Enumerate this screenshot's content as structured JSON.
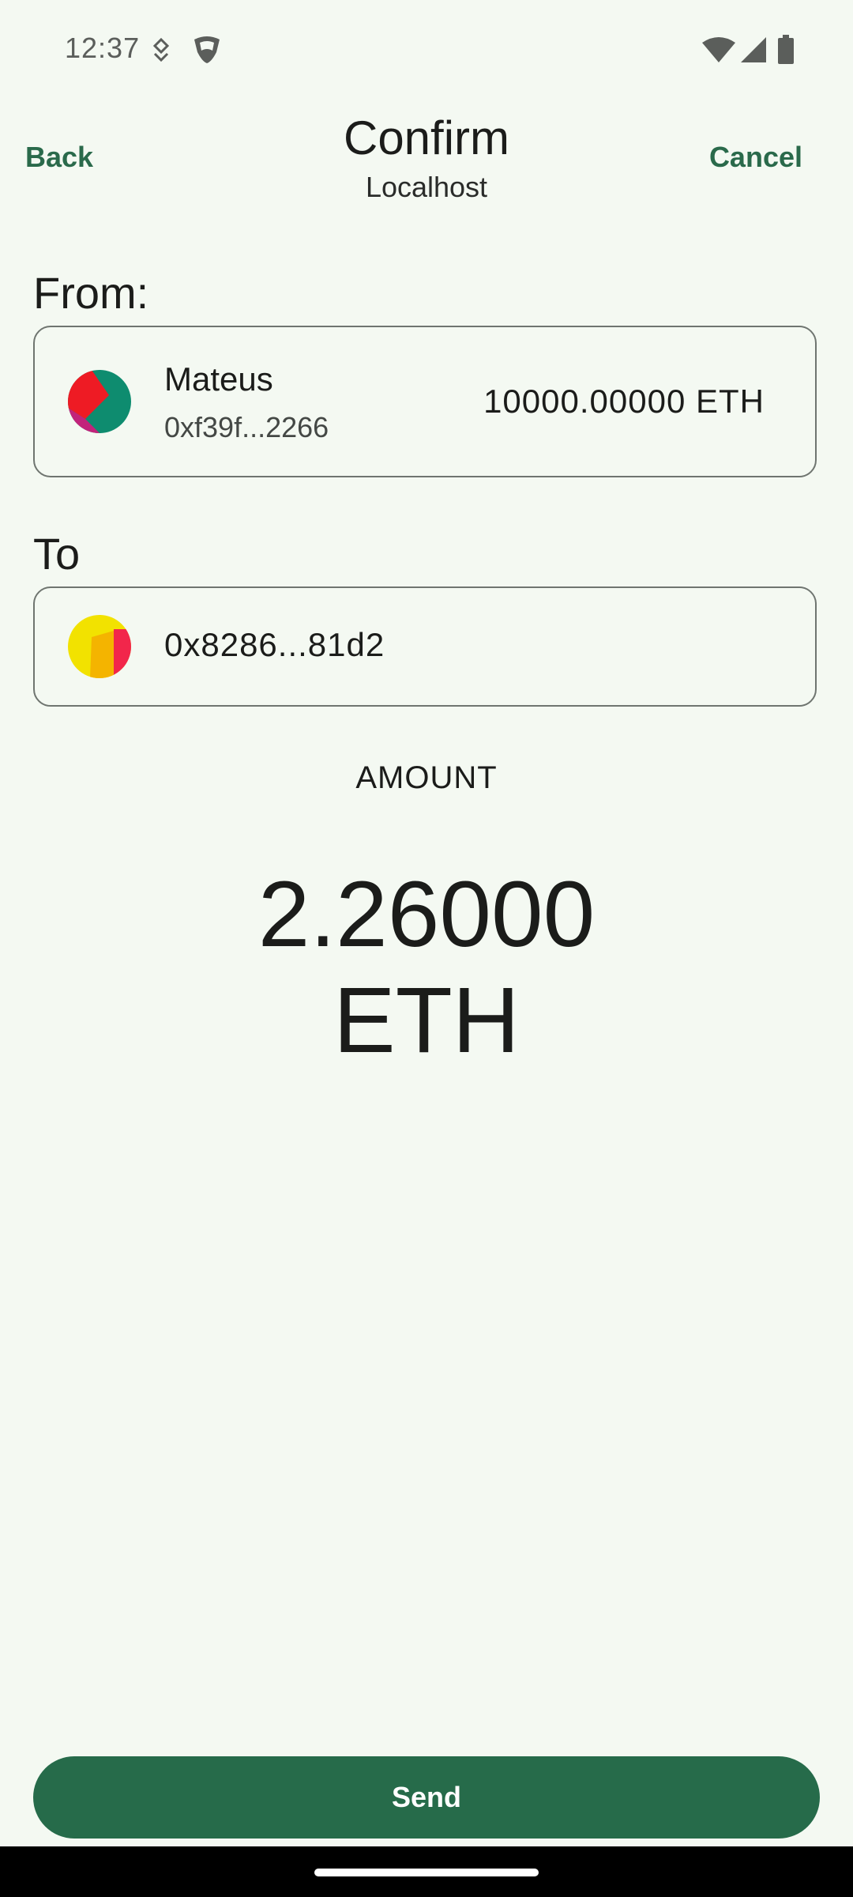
{
  "status_bar": {
    "time": "12:37",
    "icons": [
      "notification-icon",
      "shield-icon",
      "wifi-icon",
      "signal-icon",
      "battery-icon"
    ]
  },
  "header": {
    "back_label": "Back",
    "title": "Confirm",
    "subtitle": "Localhost",
    "cancel_label": "Cancel"
  },
  "from": {
    "label": "From:",
    "account_name": "Mateus",
    "address": "0xf39f...2266",
    "balance": "10000.00000 ETH"
  },
  "to": {
    "label": "To",
    "address": "0x8286...81d2"
  },
  "amount": {
    "label": "AMOUNT",
    "value": "2.26000",
    "unit": "ETH"
  },
  "actions": {
    "send_label": "Send"
  },
  "colors": {
    "background": "#f4f9f2",
    "accent": "#266b4a",
    "link": "#2a6a4b"
  }
}
